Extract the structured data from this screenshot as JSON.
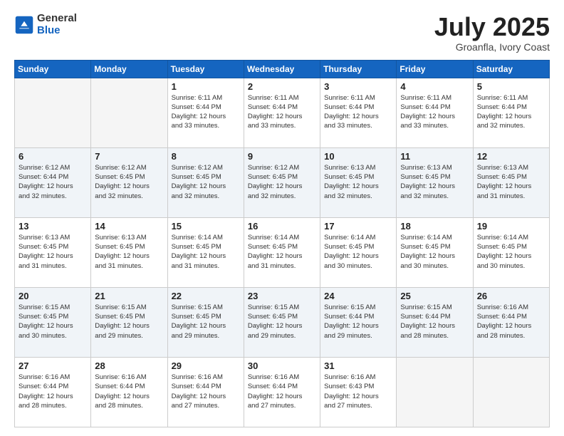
{
  "logo": {
    "general": "General",
    "blue": "Blue"
  },
  "title": {
    "month": "July 2025",
    "location": "Groanfla, Ivory Coast"
  },
  "weekdays": [
    "Sunday",
    "Monday",
    "Tuesday",
    "Wednesday",
    "Thursday",
    "Friday",
    "Saturday"
  ],
  "weeks": [
    [
      {
        "day": "",
        "info": ""
      },
      {
        "day": "",
        "info": ""
      },
      {
        "day": "1",
        "info": "Sunrise: 6:11 AM\nSunset: 6:44 PM\nDaylight: 12 hours\nand 33 minutes."
      },
      {
        "day": "2",
        "info": "Sunrise: 6:11 AM\nSunset: 6:44 PM\nDaylight: 12 hours\nand 33 minutes."
      },
      {
        "day": "3",
        "info": "Sunrise: 6:11 AM\nSunset: 6:44 PM\nDaylight: 12 hours\nand 33 minutes."
      },
      {
        "day": "4",
        "info": "Sunrise: 6:11 AM\nSunset: 6:44 PM\nDaylight: 12 hours\nand 33 minutes."
      },
      {
        "day": "5",
        "info": "Sunrise: 6:11 AM\nSunset: 6:44 PM\nDaylight: 12 hours\nand 32 minutes."
      }
    ],
    [
      {
        "day": "6",
        "info": "Sunrise: 6:12 AM\nSunset: 6:44 PM\nDaylight: 12 hours\nand 32 minutes."
      },
      {
        "day": "7",
        "info": "Sunrise: 6:12 AM\nSunset: 6:45 PM\nDaylight: 12 hours\nand 32 minutes."
      },
      {
        "day": "8",
        "info": "Sunrise: 6:12 AM\nSunset: 6:45 PM\nDaylight: 12 hours\nand 32 minutes."
      },
      {
        "day": "9",
        "info": "Sunrise: 6:12 AM\nSunset: 6:45 PM\nDaylight: 12 hours\nand 32 minutes."
      },
      {
        "day": "10",
        "info": "Sunrise: 6:13 AM\nSunset: 6:45 PM\nDaylight: 12 hours\nand 32 minutes."
      },
      {
        "day": "11",
        "info": "Sunrise: 6:13 AM\nSunset: 6:45 PM\nDaylight: 12 hours\nand 32 minutes."
      },
      {
        "day": "12",
        "info": "Sunrise: 6:13 AM\nSunset: 6:45 PM\nDaylight: 12 hours\nand 31 minutes."
      }
    ],
    [
      {
        "day": "13",
        "info": "Sunrise: 6:13 AM\nSunset: 6:45 PM\nDaylight: 12 hours\nand 31 minutes."
      },
      {
        "day": "14",
        "info": "Sunrise: 6:13 AM\nSunset: 6:45 PM\nDaylight: 12 hours\nand 31 minutes."
      },
      {
        "day": "15",
        "info": "Sunrise: 6:14 AM\nSunset: 6:45 PM\nDaylight: 12 hours\nand 31 minutes."
      },
      {
        "day": "16",
        "info": "Sunrise: 6:14 AM\nSunset: 6:45 PM\nDaylight: 12 hours\nand 31 minutes."
      },
      {
        "day": "17",
        "info": "Sunrise: 6:14 AM\nSunset: 6:45 PM\nDaylight: 12 hours\nand 30 minutes."
      },
      {
        "day": "18",
        "info": "Sunrise: 6:14 AM\nSunset: 6:45 PM\nDaylight: 12 hours\nand 30 minutes."
      },
      {
        "day": "19",
        "info": "Sunrise: 6:14 AM\nSunset: 6:45 PM\nDaylight: 12 hours\nand 30 minutes."
      }
    ],
    [
      {
        "day": "20",
        "info": "Sunrise: 6:15 AM\nSunset: 6:45 PM\nDaylight: 12 hours\nand 30 minutes."
      },
      {
        "day": "21",
        "info": "Sunrise: 6:15 AM\nSunset: 6:45 PM\nDaylight: 12 hours\nand 29 minutes."
      },
      {
        "day": "22",
        "info": "Sunrise: 6:15 AM\nSunset: 6:45 PM\nDaylight: 12 hours\nand 29 minutes."
      },
      {
        "day": "23",
        "info": "Sunrise: 6:15 AM\nSunset: 6:45 PM\nDaylight: 12 hours\nand 29 minutes."
      },
      {
        "day": "24",
        "info": "Sunrise: 6:15 AM\nSunset: 6:44 PM\nDaylight: 12 hours\nand 29 minutes."
      },
      {
        "day": "25",
        "info": "Sunrise: 6:15 AM\nSunset: 6:44 PM\nDaylight: 12 hours\nand 28 minutes."
      },
      {
        "day": "26",
        "info": "Sunrise: 6:16 AM\nSunset: 6:44 PM\nDaylight: 12 hours\nand 28 minutes."
      }
    ],
    [
      {
        "day": "27",
        "info": "Sunrise: 6:16 AM\nSunset: 6:44 PM\nDaylight: 12 hours\nand 28 minutes."
      },
      {
        "day": "28",
        "info": "Sunrise: 6:16 AM\nSunset: 6:44 PM\nDaylight: 12 hours\nand 28 minutes."
      },
      {
        "day": "29",
        "info": "Sunrise: 6:16 AM\nSunset: 6:44 PM\nDaylight: 12 hours\nand 27 minutes."
      },
      {
        "day": "30",
        "info": "Sunrise: 6:16 AM\nSunset: 6:44 PM\nDaylight: 12 hours\nand 27 minutes."
      },
      {
        "day": "31",
        "info": "Sunrise: 6:16 AM\nSunset: 6:43 PM\nDaylight: 12 hours\nand 27 minutes."
      },
      {
        "day": "",
        "info": ""
      },
      {
        "day": "",
        "info": ""
      }
    ]
  ]
}
